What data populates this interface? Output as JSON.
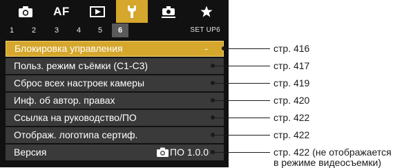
{
  "tabs": [
    {
      "icon": "camera-icon",
      "active": false
    },
    {
      "label": "AF",
      "active": false
    },
    {
      "icon": "playback-icon",
      "active": false
    },
    {
      "icon": "wrench-icon",
      "active": true
    },
    {
      "icon": "custom-functions-icon",
      "active": false
    },
    {
      "icon": "star-icon",
      "active": false
    }
  ],
  "subtabs": [
    "1",
    "2",
    "3",
    "4",
    "5",
    "6"
  ],
  "active_subtab": "6",
  "setup_label": "SET UP6",
  "menu": {
    "items": [
      {
        "label": "Блокировка управления",
        "value": "-",
        "selected": true
      },
      {
        "label": "Польз. режим съёмки (C1-C3)",
        "value": ""
      },
      {
        "label": "Сброс всех настроек камеры",
        "value": ""
      },
      {
        "label": "Инф. об автор. правах",
        "value": ""
      },
      {
        "label": "Ссылка на руководство/ПО",
        "value": ""
      },
      {
        "label": "Отображ. логотипа сертиф.",
        "value": ""
      },
      {
        "label": "Версия",
        "value": "ПО 1.0.0",
        "value_icon": "camera-icon"
      }
    ]
  },
  "refs": [
    "стр. 416",
    "стр. 417",
    "стр. 419",
    "стр. 420",
    "стр. 422",
    "стр. 422",
    "стр. 422 (не отображается",
    "в режиме видеосъемки)"
  ],
  "colors": {
    "accent": "#d5a72c",
    "row_bg": "#3a3a3a",
    "screen_bg": "#111111",
    "subtab_active": "#5a5a5a"
  }
}
